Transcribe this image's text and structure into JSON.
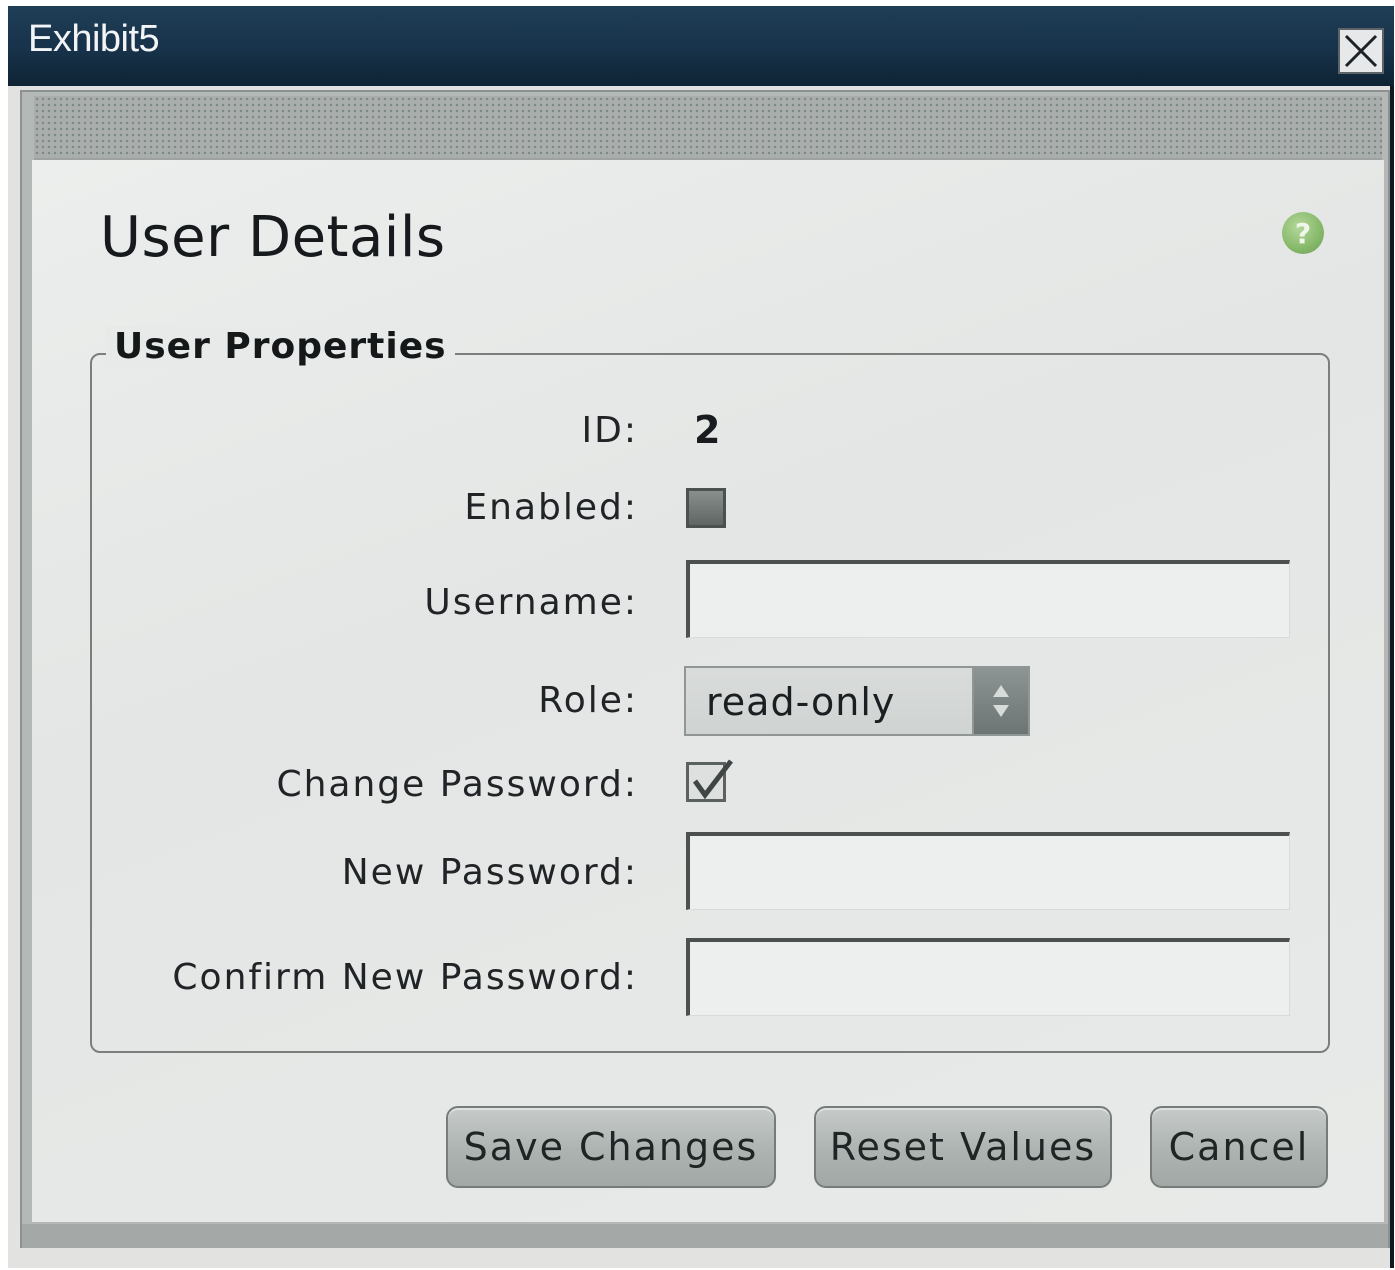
{
  "window": {
    "title": "Exhibit5",
    "close_icon": "close-icon"
  },
  "dialog": {
    "title": "User Details",
    "help_icon": "help-icon",
    "help_glyph": "?",
    "accent_color": "#8bbf6e"
  },
  "user_properties": {
    "legend": "User Properties",
    "id_label": "ID:",
    "id_value": "2",
    "enabled_label": "Enabled:",
    "enabled_checked": false,
    "username_label": "Username:",
    "username_value": "",
    "role_label": "Role:",
    "role_value": "read-only",
    "change_password_label": "Change Password:",
    "change_password_checked": true,
    "new_password_label": "New Password:",
    "new_password_value": "",
    "confirm_password_label": "Confirm New Password:",
    "confirm_password_value": ""
  },
  "buttons": {
    "save": "Save Changes",
    "reset": "Reset Values",
    "cancel": "Cancel"
  }
}
